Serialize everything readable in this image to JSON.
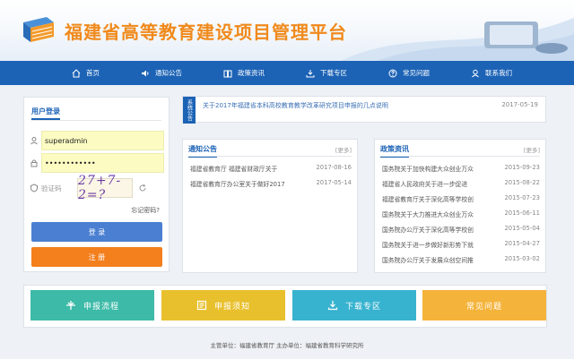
{
  "header": {
    "title": "福建省高等教育建设项目管理平台"
  },
  "nav": [
    {
      "label": "首页",
      "icon": "home-icon"
    },
    {
      "label": "通知公告",
      "icon": "speaker-icon"
    },
    {
      "label": "政策资讯",
      "icon": "book-icon"
    },
    {
      "label": "下载专区",
      "icon": "download-icon"
    },
    {
      "label": "常见问题",
      "icon": "question-icon"
    },
    {
      "label": "联系我们",
      "icon": "contact-icon"
    }
  ],
  "login": {
    "title": "用户登录",
    "username": "superadmin",
    "password": "••••••••••••",
    "captcha_label": "验证码",
    "captcha_text": "27+7-2=?",
    "forgot": "忘记密码?",
    "login_button": "登 录",
    "register_button": "注 册"
  },
  "notice": {
    "tag": "系统公告",
    "text": "关于2017年福建省本科高校教育教学改革研究项目申报的几点说明",
    "date": "2017-05-19"
  },
  "notify": {
    "title": "通知公告",
    "more": "[更多]",
    "items": [
      {
        "text": "福建省教育厅 福建省财政厅关于",
        "date": "2017-08-16"
      },
      {
        "text": "福建省教育厅办公室关于做好2017",
        "date": "2017-05-14"
      }
    ]
  },
  "policy": {
    "title": "政策资讯",
    "more": "[更多]",
    "items": [
      {
        "text": "国务院关于加快构建大众创业万众",
        "date": "2015-09-23"
      },
      {
        "text": "福建省人民政府关于进一步促进",
        "date": "2015-08-22"
      },
      {
        "text": "福建省教育厅关于深化高等学校创",
        "date": "2015-07-23"
      },
      {
        "text": "国务院关于大力推进大众创业万众",
        "date": "2015-06-11"
      },
      {
        "text": "国务院办公厅关于深化高等学校创",
        "date": "2015-05-04"
      },
      {
        "text": "国务院关于进一步做好新形势下就",
        "date": "2015-04-27"
      },
      {
        "text": "国务院办公厅关于发展众创空间推",
        "date": "2015-03-02"
      }
    ]
  },
  "big_buttons": [
    {
      "label": "申报流程",
      "icon": "flow-icon",
      "color": "#3dbaa8"
    },
    {
      "label": "申报须知",
      "icon": "notes-icon",
      "color": "#e8c02d"
    },
    {
      "label": "下载专区",
      "icon": "download-icon",
      "color": "#38b3cf"
    },
    {
      "label": "常见问题",
      "icon": "question-icon",
      "color": "#f4b33a"
    }
  ],
  "footer": "主管单位：福建省教育厅 主办单位：福建省教育科学研究所",
  "colors": {
    "nav": "#1c63b6",
    "title": "#f08a1c",
    "login_button": "#4b7fd1",
    "register_button": "#f37f1d"
  }
}
